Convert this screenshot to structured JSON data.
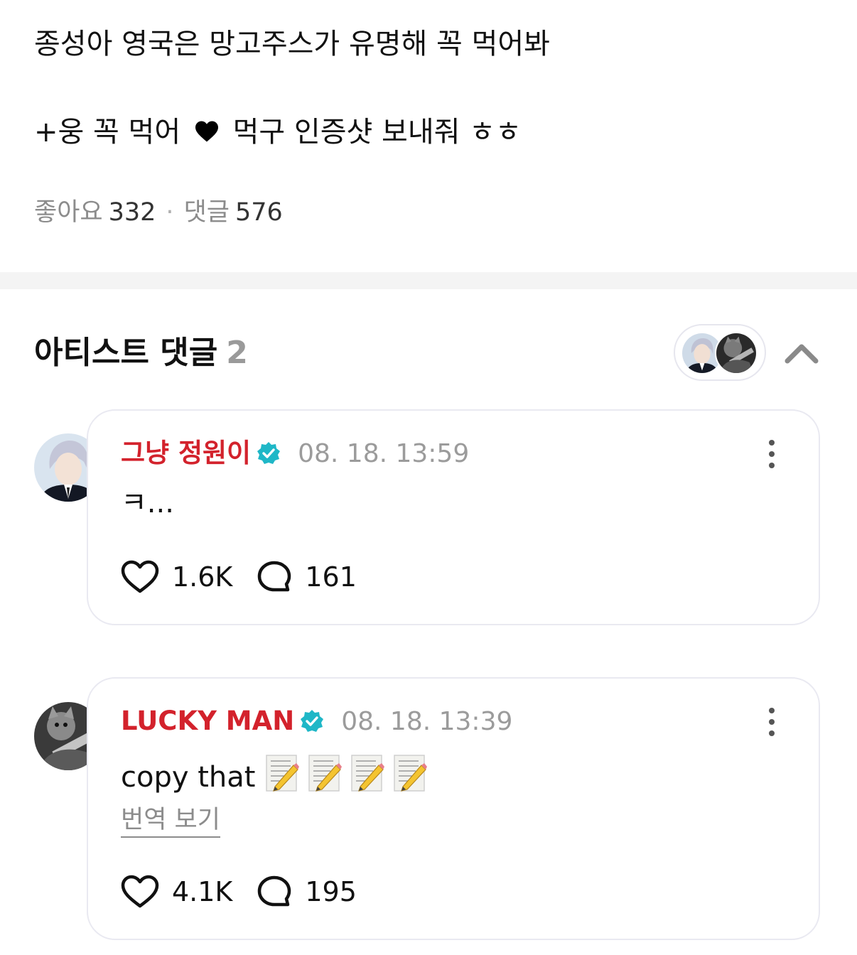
{
  "post": {
    "line1": "종성아 영국은 망고주스가 유명해 꼭 먹어봐",
    "line2_before_heart": "+웅 꼭 먹어",
    "line2_after_heart": "먹구 인증샷 보내줘 ㅎㅎ"
  },
  "stats": {
    "likes_label": "좋아요",
    "likes_count": "332",
    "separator": "·",
    "comments_label": "댓글",
    "comments_count": "576"
  },
  "artist_comments": {
    "title": "아티스트 댓글",
    "count": "2",
    "comments": [
      {
        "author": "그냥 정원이",
        "time": "08. 18. 13:59",
        "text": "ㅋ...",
        "likes": "1.6K",
        "replies": "161"
      },
      {
        "author": "LUCKY MAN",
        "time": "08. 18. 13:39",
        "text": "copy that",
        "emoji": "memo-icon",
        "emoji_count": 4,
        "translate_label": "번역 보기",
        "likes": "4.1K",
        "replies": "195"
      }
    ]
  },
  "colors": {
    "author_name": "#d3222c",
    "verified_badge": "#1fb7c7",
    "muted_text": "#8c8c8c",
    "card_border": "#e9e9f1"
  }
}
